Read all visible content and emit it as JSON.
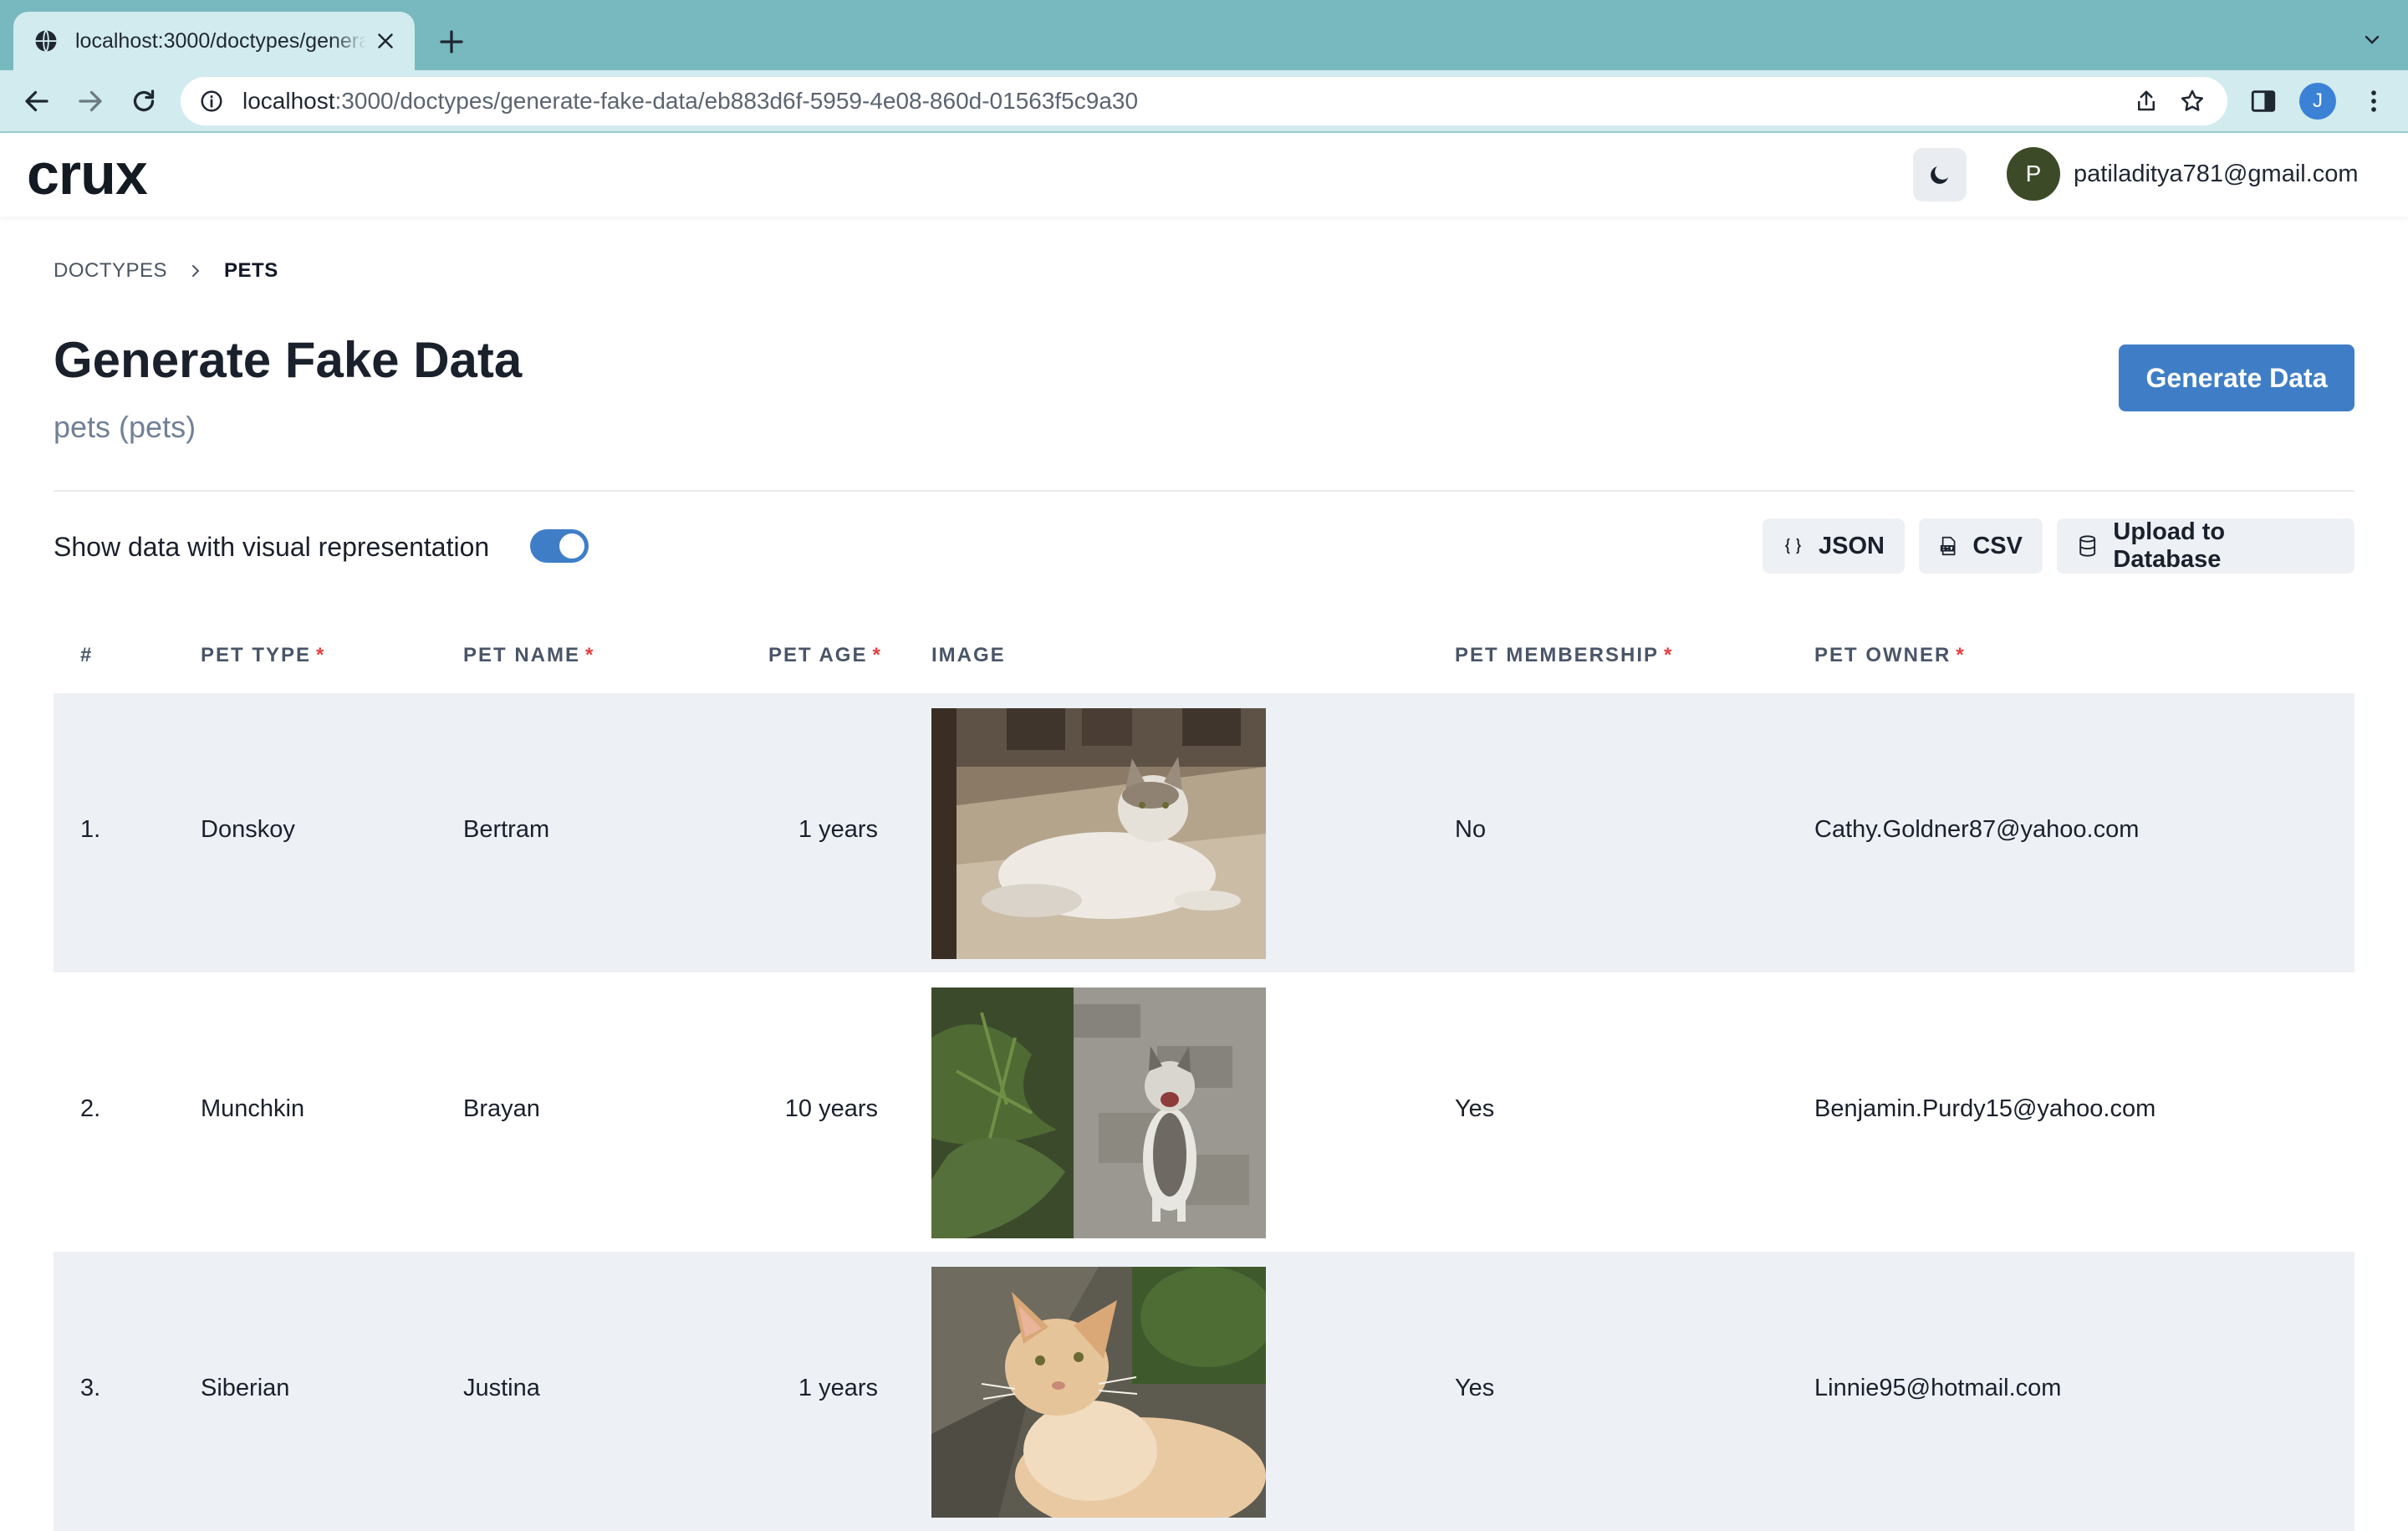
{
  "browser": {
    "tab_title": "localhost:3000/doctypes/generate-fake-data/eb883d6f-5959-4e08-860d-01563f5c9a30",
    "url_host": "localhost",
    "url_rest": ":3000/doctypes/generate-fake-data/eb883d6f-5959-4e08-860d-01563f5c9a30",
    "profile_initial": "J"
  },
  "header": {
    "brand": "crux",
    "avatar_initial": "P",
    "user_email": "patiladitya781@gmail.com"
  },
  "breadcrumb": {
    "items": [
      "DOCTYPES",
      "PETS"
    ]
  },
  "page": {
    "title": "Generate Fake Data",
    "subtitle": "pets (pets)",
    "generate_label": "Generate Data",
    "toggle_label": "Show data with visual representation",
    "toggle_on": true
  },
  "actions": {
    "json_label": "JSON",
    "csv_label": "CSV",
    "upload_label": "Upload to Database"
  },
  "table": {
    "columns": [
      {
        "label": "#",
        "required": false
      },
      {
        "label": "PET TYPE",
        "required": true
      },
      {
        "label": "PET NAME",
        "required": true
      },
      {
        "label": "PET AGE",
        "required": true
      },
      {
        "label": "IMAGE",
        "required": false
      },
      {
        "label": "PET MEMBERSHIP",
        "required": true
      },
      {
        "label": "PET OWNER",
        "required": true
      }
    ],
    "required_marker": "*",
    "rows": [
      {
        "index": "1.",
        "pet_type": "Donskoy",
        "pet_name": "Bertram",
        "pet_age": "1 years",
        "image": "cat-photo-lying",
        "membership": "No",
        "owner": "Cathy.Goldner87@yahoo.com"
      },
      {
        "index": "2.",
        "pet_type": "Munchkin",
        "pet_name": "Brayan",
        "pet_age": "10 years",
        "image": "cat-photo-sitting",
        "membership": "Yes",
        "owner": "Benjamin.Purdy15@yahoo.com"
      },
      {
        "index": "3.",
        "pet_type": "Siberian",
        "pet_name": "Justina",
        "pet_age": "1 years",
        "image": "cat-photo-orange",
        "membership": "Yes",
        "owner": "Linnie95@hotmail.com"
      }
    ]
  },
  "colors": {
    "primary": "#3f7ec7",
    "required": "#e53e3e",
    "row_stripe": "#edf1f6",
    "chrome": "#78b8bf"
  }
}
